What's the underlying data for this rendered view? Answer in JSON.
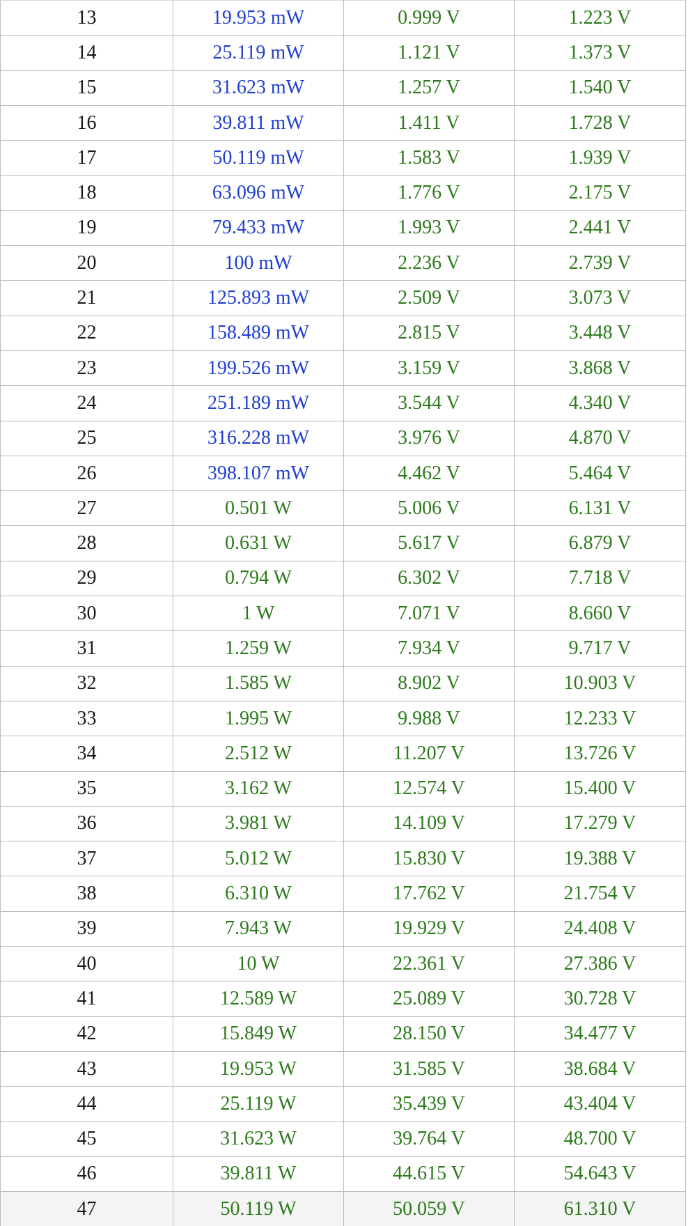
{
  "colors": {
    "index_text": "#1a1a1a",
    "milliwatt_text": "#1f3fd0",
    "watt_text": "#2c7a1b",
    "volt_text": "#2c7a1b",
    "grid_line": "#bcbcbc"
  },
  "rows": [
    {
      "index": "13",
      "power": "19.953 mW",
      "v1": "0.999 V",
      "v2": "1.223 V",
      "unit": "mW"
    },
    {
      "index": "14",
      "power": "25.119 mW",
      "v1": "1.121 V",
      "v2": "1.373 V",
      "unit": "mW"
    },
    {
      "index": "15",
      "power": "31.623 mW",
      "v1": "1.257 V",
      "v2": "1.540 V",
      "unit": "mW"
    },
    {
      "index": "16",
      "power": "39.811 mW",
      "v1": "1.411 V",
      "v2": "1.728 V",
      "unit": "mW"
    },
    {
      "index": "17",
      "power": "50.119 mW",
      "v1": "1.583 V",
      "v2": "1.939 V",
      "unit": "mW"
    },
    {
      "index": "18",
      "power": "63.096 mW",
      "v1": "1.776 V",
      "v2": "2.175 V",
      "unit": "mW"
    },
    {
      "index": "19",
      "power": "79.433 mW",
      "v1": "1.993 V",
      "v2": "2.441 V",
      "unit": "mW"
    },
    {
      "index": "20",
      "power": "100 mW",
      "v1": "2.236 V",
      "v2": "2.739 V",
      "unit": "mW"
    },
    {
      "index": "21",
      "power": "125.893 mW",
      "v1": "2.509 V",
      "v2": "3.073 V",
      "unit": "mW"
    },
    {
      "index": "22",
      "power": "158.489 mW",
      "v1": "2.815 V",
      "v2": "3.448 V",
      "unit": "mW"
    },
    {
      "index": "23",
      "power": "199.526 mW",
      "v1": "3.159 V",
      "v2": "3.868 V",
      "unit": "mW"
    },
    {
      "index": "24",
      "power": "251.189 mW",
      "v1": "3.544 V",
      "v2": "4.340 V",
      "unit": "mW"
    },
    {
      "index": "25",
      "power": "316.228 mW",
      "v1": "3.976 V",
      "v2": "4.870 V",
      "unit": "mW"
    },
    {
      "index": "26",
      "power": "398.107 mW",
      "v1": "4.462 V",
      "v2": "5.464 V",
      "unit": "mW"
    },
    {
      "index": "27",
      "power": "0.501 W",
      "v1": "5.006 V",
      "v2": "6.131 V",
      "unit": "W"
    },
    {
      "index": "28",
      "power": "0.631 W",
      "v1": "5.617 V",
      "v2": "6.879 V",
      "unit": "W"
    },
    {
      "index": "29",
      "power": "0.794 W",
      "v1": "6.302 V",
      "v2": "7.718 V",
      "unit": "W"
    },
    {
      "index": "30",
      "power": "1 W",
      "v1": "7.071 V",
      "v2": "8.660 V",
      "unit": "W"
    },
    {
      "index": "31",
      "power": "1.259 W",
      "v1": "7.934 V",
      "v2": "9.717 V",
      "unit": "W"
    },
    {
      "index": "32",
      "power": "1.585 W",
      "v1": "8.902 V",
      "v2": "10.903 V",
      "unit": "W"
    },
    {
      "index": "33",
      "power": "1.995 W",
      "v1": "9.988 V",
      "v2": "12.233 V",
      "unit": "W"
    },
    {
      "index": "34",
      "power": "2.512 W",
      "v1": "11.207 V",
      "v2": "13.726 V",
      "unit": "W"
    },
    {
      "index": "35",
      "power": "3.162 W",
      "v1": "12.574 V",
      "v2": "15.400 V",
      "unit": "W"
    },
    {
      "index": "36",
      "power": "3.981 W",
      "v1": "14.109 V",
      "v2": "17.279 V",
      "unit": "W"
    },
    {
      "index": "37",
      "power": "5.012 W",
      "v1": "15.830 V",
      "v2": "19.388 V",
      "unit": "W"
    },
    {
      "index": "38",
      "power": "6.310 W",
      "v1": "17.762 V",
      "v2": "21.754 V",
      "unit": "W"
    },
    {
      "index": "39",
      "power": "7.943 W",
      "v1": "19.929 V",
      "v2": "24.408 V",
      "unit": "W"
    },
    {
      "index": "40",
      "power": "10 W",
      "v1": "22.361 V",
      "v2": "27.386 V",
      "unit": "W"
    },
    {
      "index": "41",
      "power": "12.589 W",
      "v1": "25.089 V",
      "v2": "30.728 V",
      "unit": "W"
    },
    {
      "index": "42",
      "power": "15.849 W",
      "v1": "28.150 V",
      "v2": "34.477 V",
      "unit": "W"
    },
    {
      "index": "43",
      "power": "19.953 W",
      "v1": "31.585 V",
      "v2": "38.684 V",
      "unit": "W"
    },
    {
      "index": "44",
      "power": "25.119 W",
      "v1": "35.439 V",
      "v2": "43.404 V",
      "unit": "W"
    },
    {
      "index": "45",
      "power": "31.623 W",
      "v1": "39.764 V",
      "v2": "48.700 V",
      "unit": "W"
    },
    {
      "index": "46",
      "power": "39.811 W",
      "v1": "44.615 V",
      "v2": "54.643 V",
      "unit": "W"
    },
    {
      "index": "47",
      "power": "50.119 W",
      "v1": "50.059 V",
      "v2": "61.310 V",
      "unit": "W"
    }
  ]
}
